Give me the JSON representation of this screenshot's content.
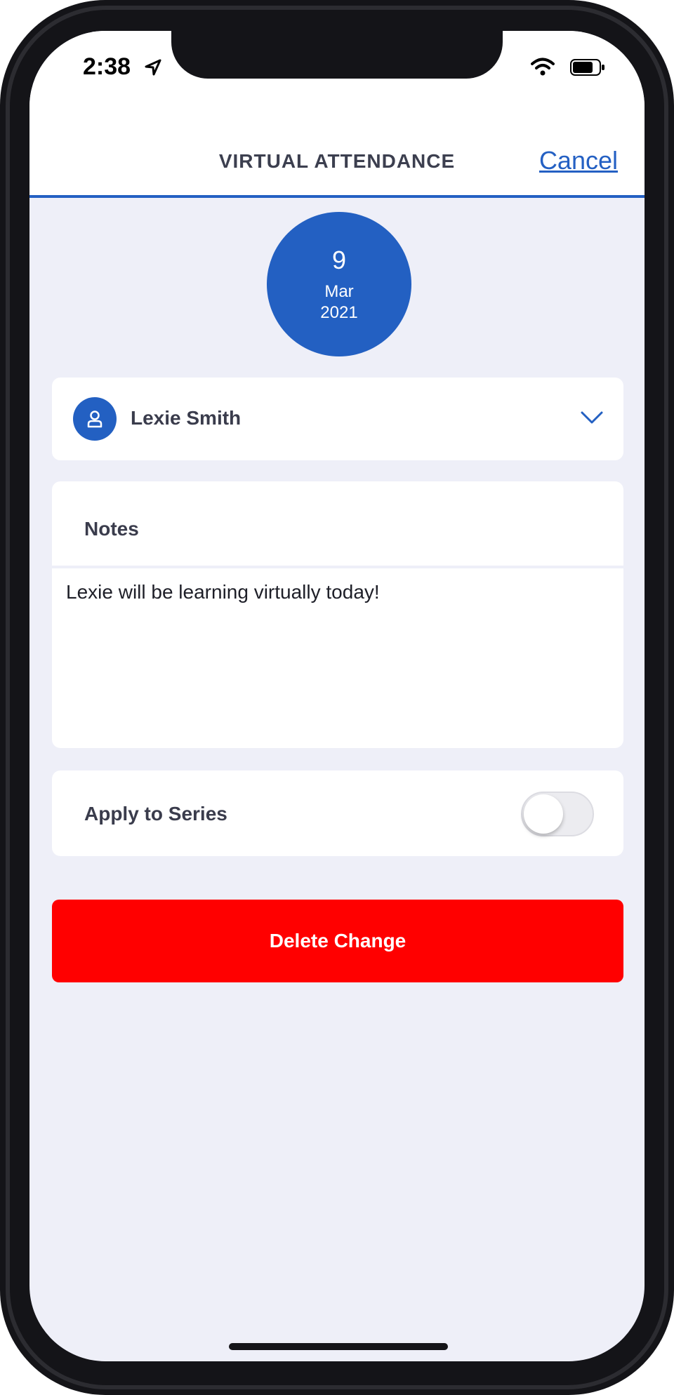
{
  "status_bar": {
    "time": "2:38"
  },
  "header": {
    "title": "VIRTUAL ATTENDANCE",
    "cancel_label": "Cancel"
  },
  "date_badge": {
    "day": "9",
    "month": "Mar",
    "year": "2021"
  },
  "student": {
    "name": "Lexie Smith"
  },
  "notes": {
    "label": "Notes",
    "value": "Lexie will be learning virtually today!"
  },
  "apply_to_series": {
    "label": "Apply to Series",
    "enabled": false
  },
  "actions": {
    "delete_label": "Delete Change"
  },
  "colors": {
    "accent": "#2360c2",
    "danger": "#ff0000",
    "background": "#eeeff8"
  }
}
